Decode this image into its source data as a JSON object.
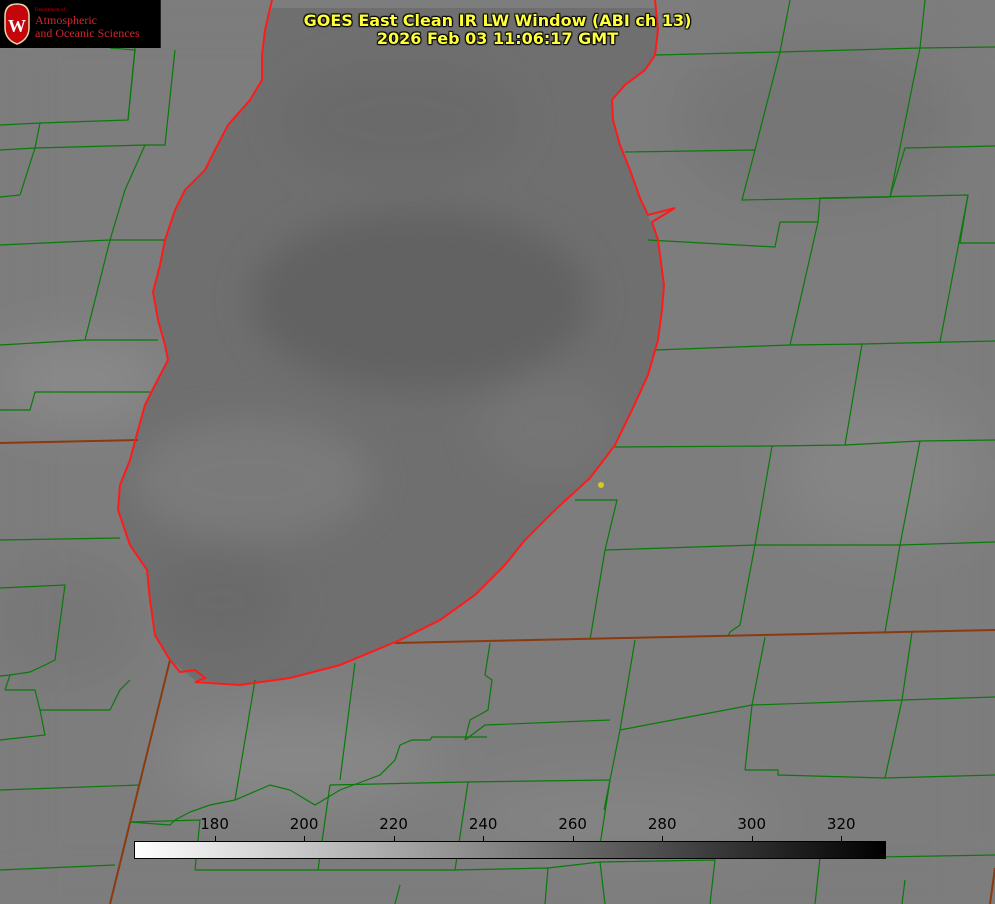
{
  "header": {
    "title_line1": "GOES East Clean IR LW Window (ABI ch 13)",
    "title_line2": "2026 Feb 03 11:06:17 GMT"
  },
  "logo": {
    "dept_text": "Department of",
    "line1": "Atmospheric",
    "line2": "and Oceanic Sciences",
    "crest_letter": "W",
    "crest_icon": "uw-crest-icon",
    "text_color": "#d4252e"
  },
  "colorbar": {
    "min": 162,
    "max": 330,
    "ticks": [
      180,
      200,
      220,
      240,
      260,
      280,
      300,
      320
    ],
    "color_low": "#ffffff",
    "color_high": "#000000"
  },
  "map": {
    "background_color": "#7d7d7d",
    "lake_color": "#6c6c6c",
    "county_line_color": "#0a7a0a",
    "state_line_color": "#8b3a10",
    "coast_color": "#ff1a1a",
    "marker_color": "#d7c81e"
  }
}
